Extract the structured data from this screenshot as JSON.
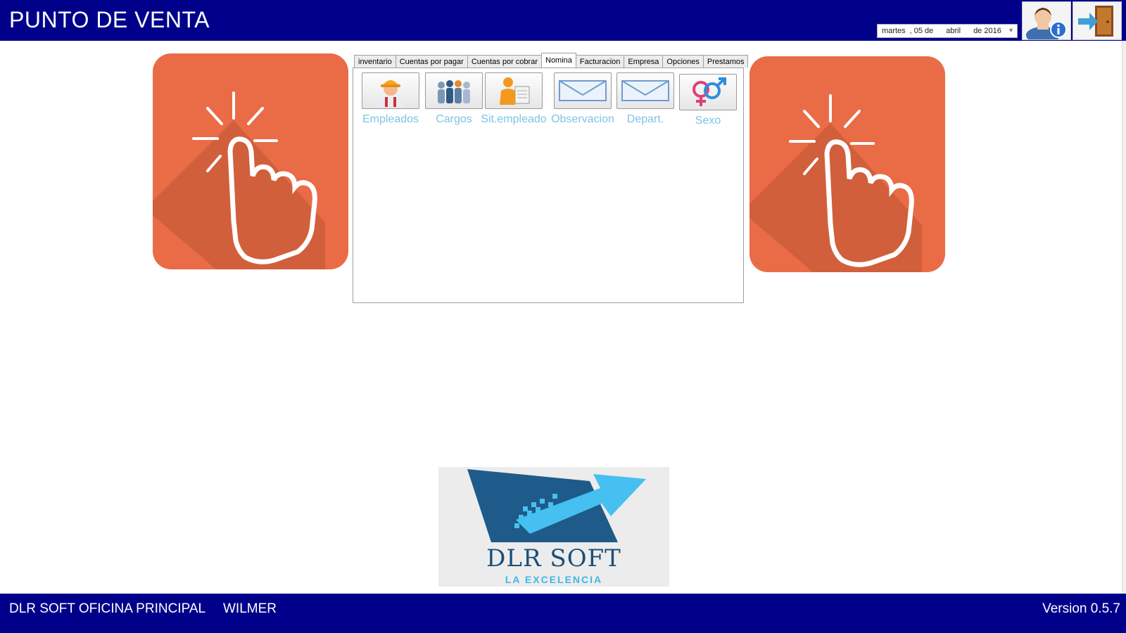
{
  "header": {
    "title": "PUNTO DE VENTA",
    "date": {
      "weekday": "martes",
      "day": ", 05 de",
      "month": "abril",
      "year": "de 2016"
    },
    "user_info_icon": "user-info-icon",
    "exit_icon": "exit-door-icon"
  },
  "tabs": [
    {
      "label": "inventario"
    },
    {
      "label": "Cuentas por pagar"
    },
    {
      "label": "Cuentas por cobrar"
    },
    {
      "label": "Nomina",
      "active": true
    },
    {
      "label": "Facturacion"
    },
    {
      "label": "Empresa"
    },
    {
      "label": "Opciones"
    },
    {
      "label": "Prestamos"
    }
  ],
  "tools": [
    {
      "label": "Empleados",
      "icon": "worker-icon"
    },
    {
      "label": "Cargos",
      "icon": "group-people-icon"
    },
    {
      "label": "Sit.empleado",
      "icon": "person-document-icon"
    },
    {
      "label": "Observacion",
      "icon": "envelope-icon"
    },
    {
      "label": "Depart.",
      "icon": "envelope-icon"
    },
    {
      "label": "Sexo",
      "icon": "gender-symbols-icon"
    }
  ],
  "tiles": {
    "icon": "tap-hand-icon",
    "color": "#e96c46"
  },
  "logo": {
    "name": "DLR SOFT",
    "slogan": "LA EXCELENCIA"
  },
  "footer": {
    "office": "DLR SOFT OFICINA PRINCIPAL",
    "user": "WILMER",
    "version": "Version 0.5.7"
  },
  "colors": {
    "bar": "#00008b",
    "tool_label": "#7fc3e8",
    "logo_dark": "#1b4f78",
    "logo_light": "#3fb6e8"
  }
}
